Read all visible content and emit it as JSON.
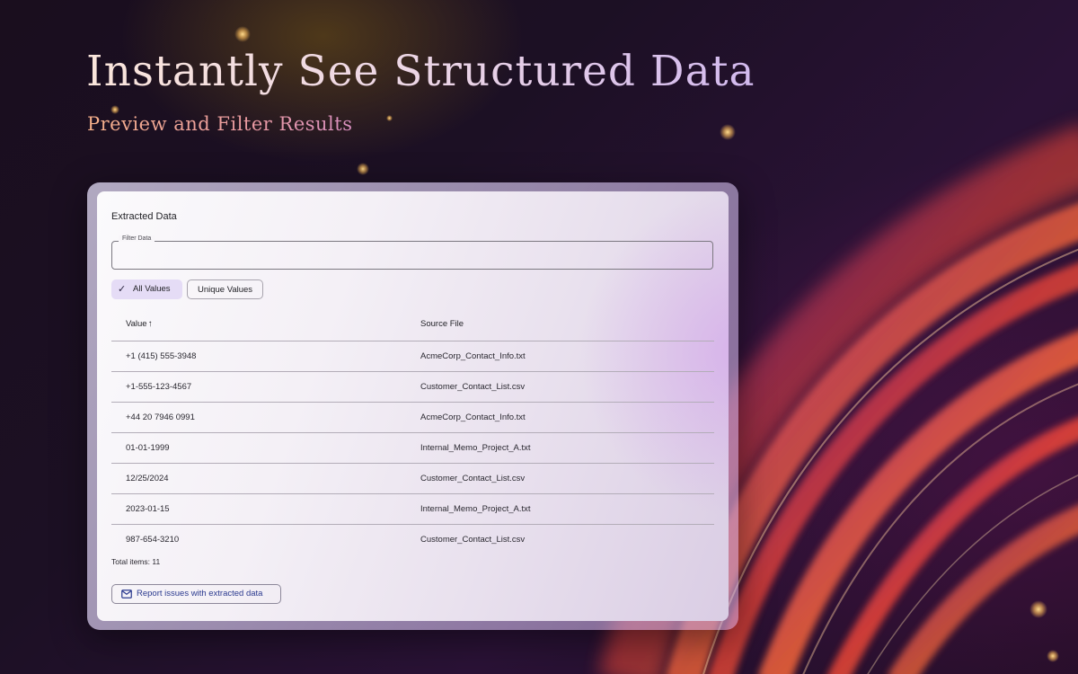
{
  "hero": {
    "title": "Instantly See Structured Data",
    "subtitle": "Preview and Filter Results"
  },
  "panel": {
    "title": "Extracted Data",
    "filter": {
      "label": "Filter Data",
      "value": "",
      "placeholder": ""
    },
    "chips": {
      "all_values": "All Values",
      "unique_values": "Unique Values",
      "selected": "all_values"
    },
    "table": {
      "headers": {
        "value": "Value",
        "source_file": "Source File"
      },
      "sort": {
        "column": "value",
        "direction": "ascending"
      },
      "rows": [
        {
          "value": "+1 (415) 555-3948",
          "source": "AcmeCorp_Contact_Info.txt"
        },
        {
          "value": "+1-555-123-4567",
          "source": "Customer_Contact_List.csv"
        },
        {
          "value": "+44 20 7946 0991",
          "source": "AcmeCorp_Contact_Info.txt"
        },
        {
          "value": "01-01-1999",
          "source": "Internal_Memo_Project_A.txt"
        },
        {
          "value": "12/25/2024",
          "source": "Customer_Contact_List.csv"
        },
        {
          "value": "2023-01-15",
          "source": "Internal_Memo_Project_A.txt"
        },
        {
          "value": "987-654-3210",
          "source": "Customer_Contact_List.csv"
        }
      ]
    },
    "total_items": "Total items: 11",
    "report_button": "Report issues with extracted data"
  },
  "icons": {
    "check": "check-icon",
    "sort": "arrow-up-icon",
    "mail": "mail-icon"
  },
  "colors": {
    "background": "#1c1024",
    "chip_selected": "#e5dcf6",
    "report_text": "#2b3a8f"
  }
}
